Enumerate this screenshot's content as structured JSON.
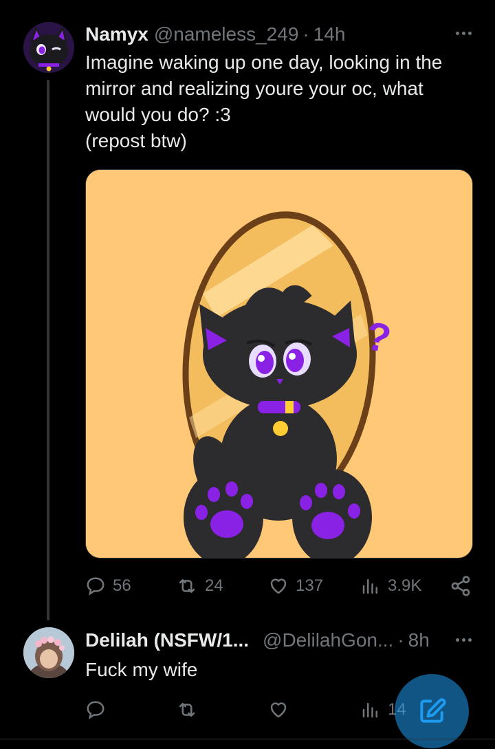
{
  "main_tweet": {
    "display_name": "Namyx",
    "handle": "@nameless_249",
    "separator": "·",
    "time": "14h",
    "text": "Imagine waking up one day, looking in the\nmirror and realizing youre your oc, what\nwould you do? :3\n(repost btw)",
    "actions": {
      "replies": "56",
      "reposts": "24",
      "likes": "137",
      "views": "3.9K"
    }
  },
  "reply_tweet": {
    "display_name": "Delilah (NSFW/1...",
    "handle": "@DelilahGon...",
    "separator": "·",
    "time": "8h",
    "text": "Fuck my wife",
    "actions": {
      "views": "14"
    }
  },
  "colors": {
    "background": "#000000",
    "text": "#e7e9ea",
    "muted": "#71767b",
    "accent": "#1d9bf0",
    "media_background": "#ffc876",
    "oc_purple": "#8a22e6"
  },
  "icons": [
    "reply-icon",
    "repost-icon",
    "like-icon",
    "views-icon",
    "share-icon",
    "more-icon",
    "compose-icon"
  ]
}
